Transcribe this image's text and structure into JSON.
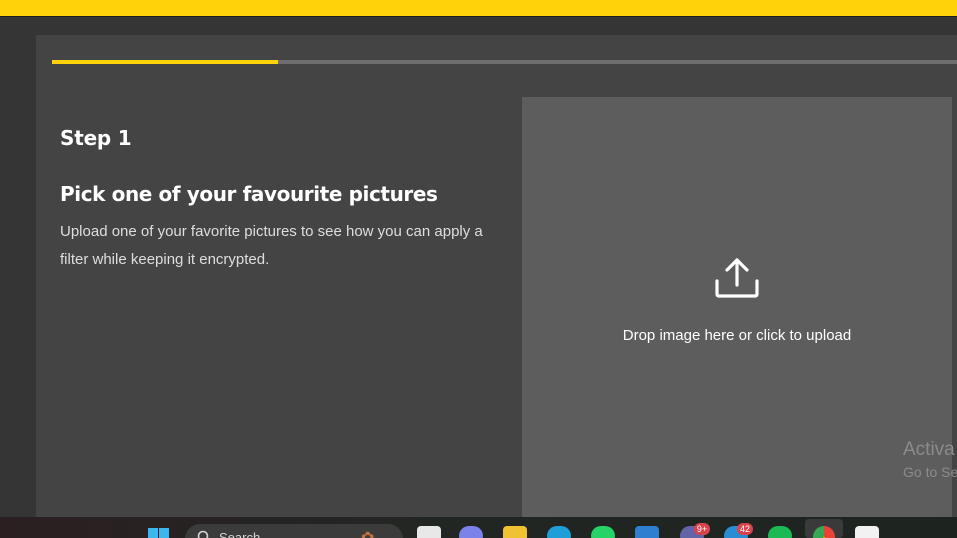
{
  "wizard": {
    "progress": 0.25,
    "step_label": "Step 1",
    "heading": "Pick one of your favourite pictures",
    "description": "Upload one of your favorite pictures to see how you can apply a filter while keeping it encrypted."
  },
  "dropzone": {
    "icon": "upload-icon",
    "text": "Drop image here or click to upload"
  },
  "watermark": {
    "title": "Activa",
    "subtitle": "Go to Se"
  },
  "taskbar": {
    "search_label": "Search",
    "badges": {
      "teams": "9+",
      "mail": "42"
    }
  },
  "colors": {
    "accent": "#ffd20a",
    "card": "#444444",
    "dropzone": "#5d5d5d"
  }
}
